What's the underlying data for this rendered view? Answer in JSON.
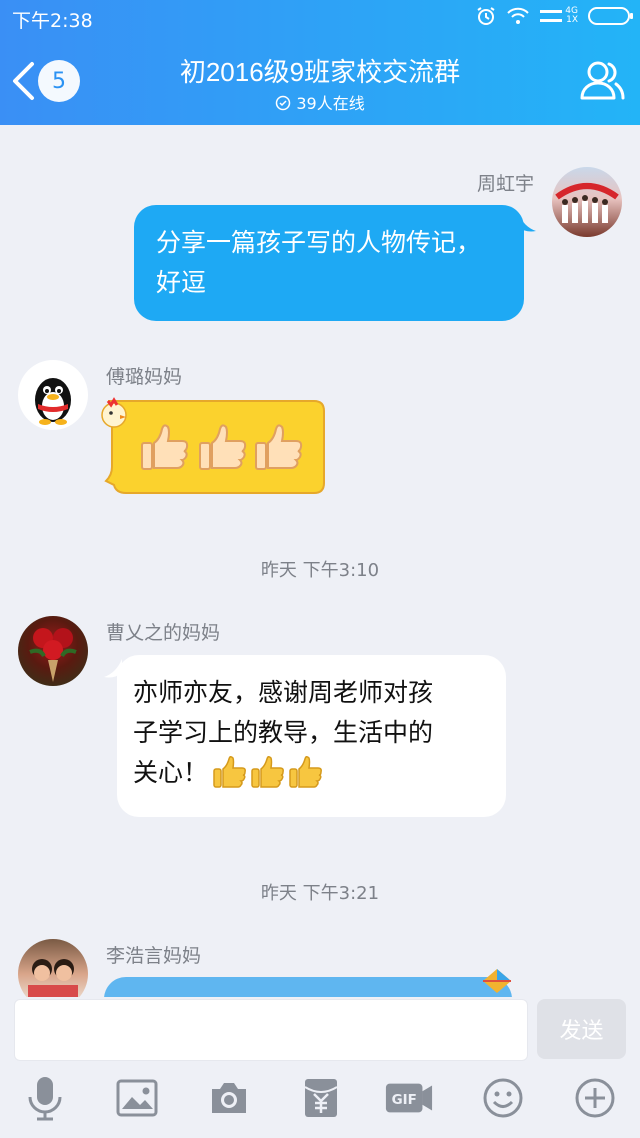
{
  "status_bar": {
    "time": "下午2:38",
    "network_top": "4G",
    "network_bottom": "1X"
  },
  "header": {
    "back_count": "5",
    "title": "初2016级9班家校交流群",
    "online_text": "39人在线"
  },
  "messages": [
    {
      "sender": "周虹宇",
      "text": "分享一篇孩子写的人物传记，好逗"
    },
    {
      "sender": "傅璐妈妈",
      "sticker": "three-thumbs-up-sticker"
    },
    {
      "timestamp": "昨天 下午3:10"
    },
    {
      "sender": "曹乂之的妈妈",
      "text_line1": "亦师亦友，感谢周老师对孩",
      "text_line2": "子学习上的教导，生活中的",
      "text_line3": "关心！"
    },
    {
      "timestamp": "昨天 下午3:21"
    },
    {
      "sender": "李浩言妈妈"
    }
  ],
  "input": {
    "placeholder": "",
    "send_label": "发送"
  },
  "toolbar": [
    "microphone-icon",
    "image-icon",
    "camera-icon",
    "red-packet-icon",
    "gif-icon",
    "emoji-icon",
    "plus-icon"
  ],
  "colors": {
    "header_start": "#3a8ff5",
    "header_end": "#23b4f7",
    "bubble_blue": "#1ea9f4",
    "background": "#eef0f6"
  }
}
